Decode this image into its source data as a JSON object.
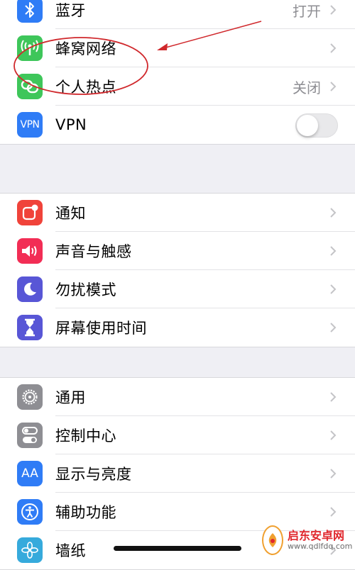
{
  "group1": {
    "items": [
      {
        "label": "蓝牙",
        "value": "打开"
      },
      {
        "label": "蜂窝网络",
        "value": ""
      },
      {
        "label": "个人热点",
        "value": "关闭"
      },
      {
        "label": "VPN",
        "icon_text": "VPN",
        "toggle": "off"
      }
    ]
  },
  "group2": {
    "items": [
      {
        "label": "通知"
      },
      {
        "label": "声音与触感"
      },
      {
        "label": "勿扰模式"
      },
      {
        "label": "屏幕使用时间"
      }
    ]
  },
  "group3": {
    "items": [
      {
        "label": "通用"
      },
      {
        "label": "控制中心"
      },
      {
        "label": "显示与亮度",
        "icon_text": "AA"
      },
      {
        "label": "辅助功能"
      },
      {
        "label": "墙纸"
      }
    ]
  },
  "watermark": {
    "title": "启东安卓网",
    "url": "www.qdlfdq.com"
  },
  "colors": {
    "bluetooth": "#2f7cf6",
    "cellular": "#3ec65a",
    "hotspot": "#3ec65a",
    "vpn": "#2f7cf6",
    "notifications": "#f0433a",
    "sounds": "#f22d55",
    "dnd": "#5856d6",
    "screentime": "#5856d6",
    "general": "#8e8e93",
    "control": "#8e8e93",
    "display": "#2f7cf6",
    "accessibility": "#2f7cf6",
    "wallpaper": "#36aadc",
    "annotation": "#d0282c"
  }
}
